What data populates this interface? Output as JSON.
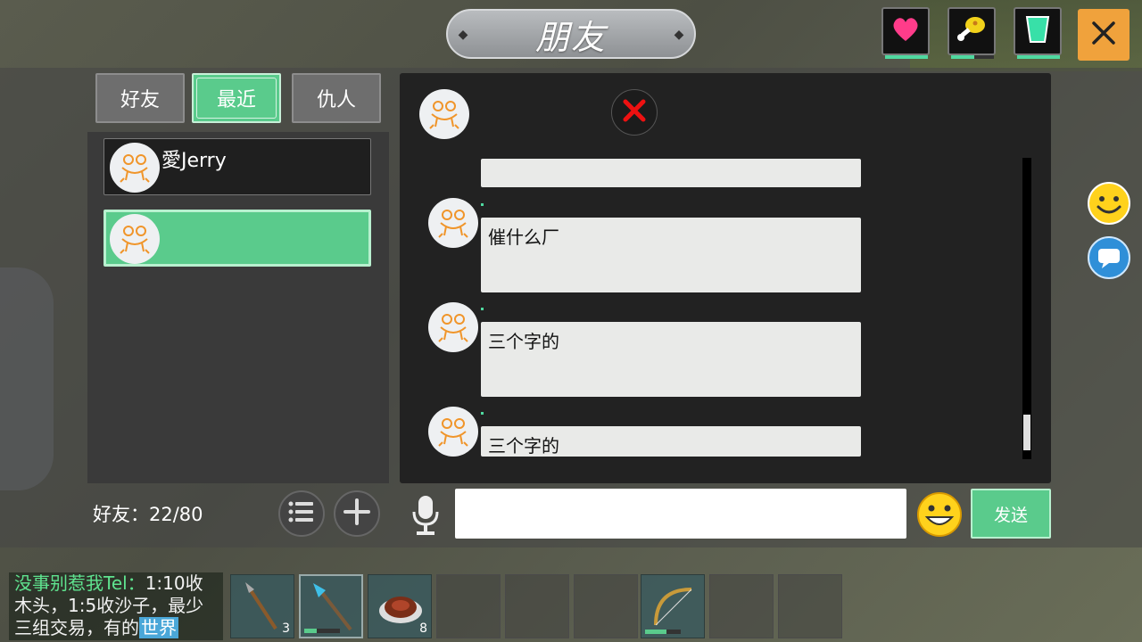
{
  "window": {
    "title": "朋友",
    "close_label": "✕"
  },
  "stats": [
    {
      "name": "health",
      "icon": "heart-icon",
      "level": 1.0
    },
    {
      "name": "hunger",
      "icon": "drumstick-icon",
      "level": 0.55
    },
    {
      "name": "thirst",
      "icon": "cup-icon",
      "level": 1.0
    }
  ],
  "tabs": [
    {
      "label": "好友",
      "active": false
    },
    {
      "label": "最近",
      "active": true
    },
    {
      "label": "仇人",
      "active": false
    }
  ],
  "friends": [
    {
      "name": "愛Jerry",
      "selected": false
    },
    {
      "name": "",
      "selected": true
    }
  ],
  "friend_count": "好友：22/80",
  "messages": [
    {
      "text": ""
    },
    {
      "text": "催什么厂"
    },
    {
      "text": "三个字的"
    },
    {
      "text": "三个字的"
    }
  ],
  "input": {
    "value": "",
    "placeholder": ""
  },
  "send_label": "发送",
  "world_chat": {
    "name": "没事别惹我",
    "tel": "Tel：",
    "text": "1:10收木头，1:5收沙子，最少三组交易，有的",
    "tag": "世界"
  },
  "hotbar": [
    {
      "item": "wooden-spear",
      "count": "3",
      "durability": null,
      "selected": false
    },
    {
      "item": "crystal-spear",
      "count": "",
      "durability": 0.35,
      "selected": true
    },
    {
      "item": "cooked-steak",
      "count": "8",
      "durability": null,
      "selected": false
    },
    {
      "item": "",
      "count": "",
      "durability": null,
      "selected": false
    },
    {
      "item": "",
      "count": "",
      "durability": null,
      "selected": false
    },
    {
      "item": "",
      "count": "",
      "durability": null,
      "selected": false
    },
    {
      "item": "bow",
      "count": "",
      "durability": 0.6,
      "selected": false
    },
    {
      "item": "",
      "count": "",
      "durability": null,
      "selected": false
    },
    {
      "item": "",
      "count": "",
      "durability": null,
      "selected": false
    }
  ]
}
